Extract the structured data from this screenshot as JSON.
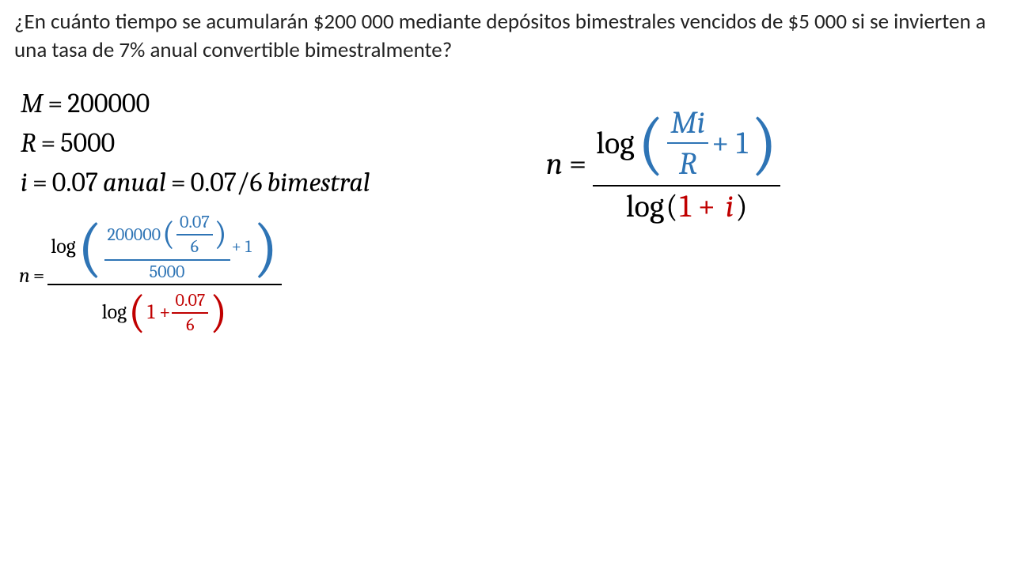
{
  "question": "¿En cuánto tiempo se acumularán $200 000 mediante depósitos bimestrales vencidos de $5 000 si se invierten a una tasa de 7% anual convertible bimestralmente?",
  "given": {
    "M_label": "M",
    "M_value": "200000",
    "R_label": "R",
    "R_value": "5000",
    "i_label": "i",
    "i_annual": "0.07",
    "unit_annual": "anual",
    "i_bim_expr": "0.07/6",
    "unit_bim": "bimestral"
  },
  "formula": {
    "n": "n",
    "eq": "=",
    "log": "log",
    "Mi": "Mi",
    "R": "R",
    "plus1": "+ 1",
    "one_plus_i": "1 +",
    "i": "i"
  },
  "subst": {
    "n": "n",
    "eq": "=",
    "log": "log",
    "M_val": "200000",
    "rate_num": "0.07",
    "rate_den": "6",
    "R_val": "5000",
    "plus1": "+ 1",
    "one_plus": "1 +"
  }
}
